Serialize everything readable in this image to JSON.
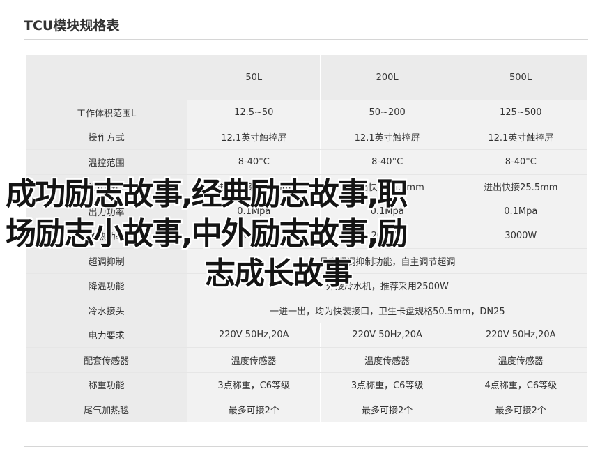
{
  "page": {
    "title": "TCU模块规格表"
  },
  "table": {
    "header": [
      "",
      "50L",
      "200L",
      "500L"
    ],
    "rows": [
      {
        "label": "工作体积范围L",
        "cells": [
          "12.5~50",
          "50~200",
          "125~500"
        ]
      },
      {
        "label": "操作方式",
        "cells": [
          "12.1英寸触控屏",
          "12.1英寸触控屏",
          "12.1英寸触控屏"
        ]
      },
      {
        "label": "温控范围",
        "cells": [
          "8-40°C",
          "8-40°C",
          "8-40°C"
        ]
      },
      {
        "label": "进出接口",
        "cells": [
          "进出快接25.5mm",
          "进出快接25.5mm",
          "进出快接25.5mm"
        ]
      },
      {
        "label": "出力功率",
        "cells": [
          "0.1Mpa",
          "0.1Mpa",
          "0.1Mpa"
        ]
      },
      {
        "label": "加热功率",
        "cells": [
          "1000W",
          "2000W",
          "3000W"
        ]
      },
      {
        "label": "超调抑制",
        "span": "具有超调抑制功能，自主调节超调"
      },
      {
        "label": "降温功能",
        "span": "外接冷水机，推荐采用2500W"
      },
      {
        "label": "冷水接头",
        "span": "一进一出，均为快装接口，卫生卡盘规格50.5mm，DN25"
      },
      {
        "label": "电力要求",
        "cells": [
          "220V 50Hz,20A",
          "220V 50Hz,20A",
          "220V 50Hz,20A"
        ]
      },
      {
        "label": "配套传感器",
        "cells": [
          "温度传感器",
          "温度传感器",
          "温度传感器"
        ]
      },
      {
        "label": "称重功能",
        "cells": [
          "3点称重，C6等级",
          "3点称重，C6等级",
          "4点称重，C6等级"
        ]
      },
      {
        "label": "尾气加热毯",
        "cells": [
          "最多可接2个",
          "最多可接2个",
          "最多可接2个"
        ]
      }
    ]
  },
  "overlay": {
    "line1": "成功励志故事,经典励志故事,职",
    "line2": "场励志小故事,中外励志故事,励",
    "line3": "志成长故事"
  }
}
